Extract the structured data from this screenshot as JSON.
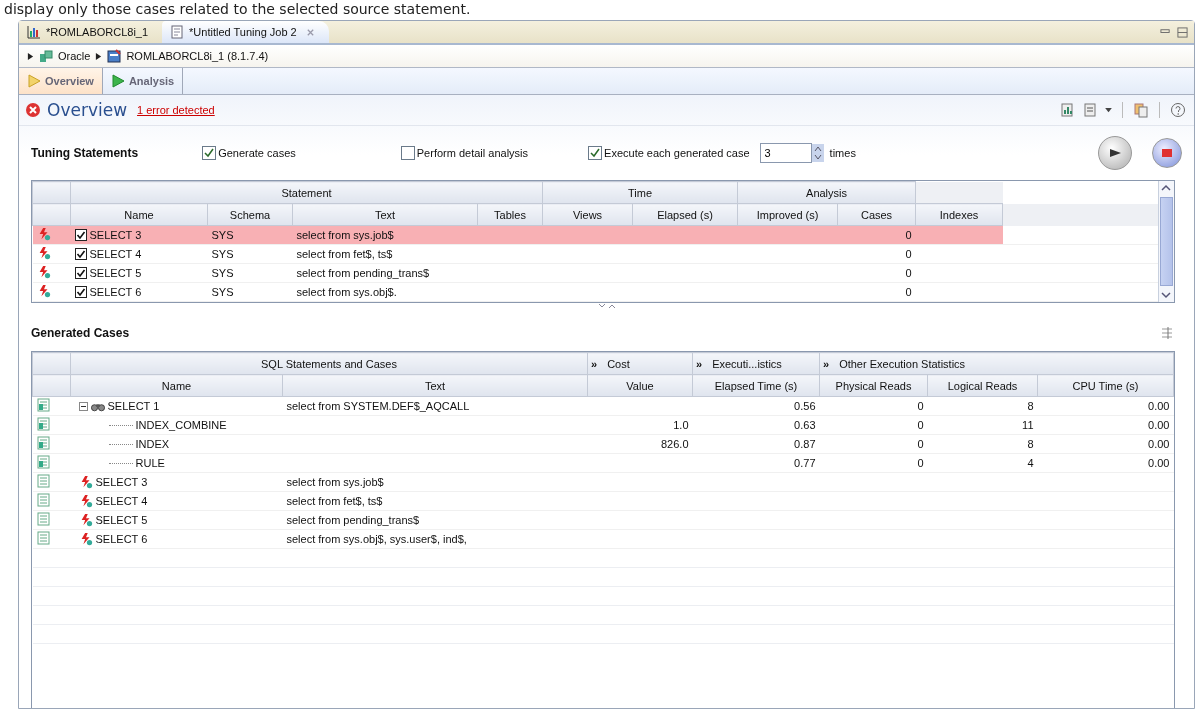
{
  "caption": "display only those cases related to the selected source statement.",
  "editor_tabs": [
    {
      "label": "*ROMLABORCL8i_1",
      "kind": "chart",
      "selected": false
    },
    {
      "label": "*Untitled Tuning Job 2",
      "kind": "job",
      "selected": true
    }
  ],
  "breadcrumb": [
    "Oracle",
    "ROMLABORCL8i_1 (8.1.7.4)"
  ],
  "page_tabs": [
    {
      "label": "Overview",
      "selected": true
    },
    {
      "label": "Analysis",
      "selected": false
    }
  ],
  "header": {
    "title": "Overview",
    "error_link": "1 error detected"
  },
  "tuning": {
    "title": "Tuning Statements",
    "options": [
      {
        "label": "Generate cases",
        "checked": true
      },
      {
        "label": "Perform detail analysis",
        "checked": false
      },
      {
        "label": "Execute each generated case",
        "checked": true
      }
    ],
    "times_value": "3",
    "times_label": "times"
  },
  "statements": {
    "groups": [
      "Statement",
      "Time",
      "Analysis"
    ],
    "columns": [
      "Name",
      "Schema",
      "Text",
      "Tables",
      "Views",
      "Elapsed (s)",
      "Improved (s)",
      "Cases",
      "Indexes"
    ],
    "rows": [
      {
        "name": "SELECT 3",
        "schema": "SYS",
        "text": "select from sys.job$",
        "cases": "0",
        "checked": true,
        "selected": true
      },
      {
        "name": "SELECT 4",
        "schema": "SYS",
        "text": "select from fet$, ts$",
        "cases": "0",
        "checked": true,
        "selected": false
      },
      {
        "name": "SELECT 5",
        "schema": "SYS",
        "text": "select from pending_trans$",
        "cases": "0",
        "checked": true,
        "selected": false
      },
      {
        "name": "SELECT 6",
        "schema": "SYS",
        "text": "select from sys.obj$.",
        "cases": "0",
        "checked": true,
        "selected": false
      }
    ]
  },
  "generated": {
    "title": "Generated Cases",
    "groups": [
      {
        "label": "SQL Statements and Cases"
      },
      {
        "label": "Cost",
        "toggle": "»"
      },
      {
        "label": "Executi...istics",
        "toggle": "»"
      },
      {
        "label": "Other Execution Statistics",
        "toggle": "»"
      }
    ],
    "columns": [
      "Name",
      "Text",
      "Value",
      "Elapsed Time (s)",
      "Physical Reads",
      "Logical Reads",
      "CPU Time (s)"
    ],
    "rows": [
      {
        "kind": "plan",
        "name": "SELECT 1",
        "text": "select from SYSTEM.DEF$_AQCALL",
        "elapsed": "0.56",
        "physical": "0",
        "logical": "8",
        "cpu": "0.00",
        "expanded": true,
        "children": [
          {
            "name": "INDEX_COMBINE",
            "value": "1.0",
            "elapsed": "0.63",
            "physical": "0",
            "logical": "11",
            "cpu": "0.00"
          },
          {
            "name": "INDEX",
            "value": "826.0",
            "elapsed": "0.87",
            "physical": "0",
            "logical": "8",
            "cpu": "0.00"
          },
          {
            "name": "RULE",
            "elapsed": "0.77",
            "physical": "0",
            "logical": "4",
            "cpu": "0.00"
          }
        ]
      },
      {
        "kind": "error",
        "name": "SELECT 3",
        "text": "select from sys.job$"
      },
      {
        "kind": "error",
        "name": "SELECT 4",
        "text": "select from fet$, ts$"
      },
      {
        "kind": "error",
        "name": "SELECT 5",
        "text": "select from pending_trans$"
      },
      {
        "kind": "error",
        "name": "SELECT 6",
        "text": "select from sys.obj$, sys.user$, ind$,"
      }
    ]
  }
}
